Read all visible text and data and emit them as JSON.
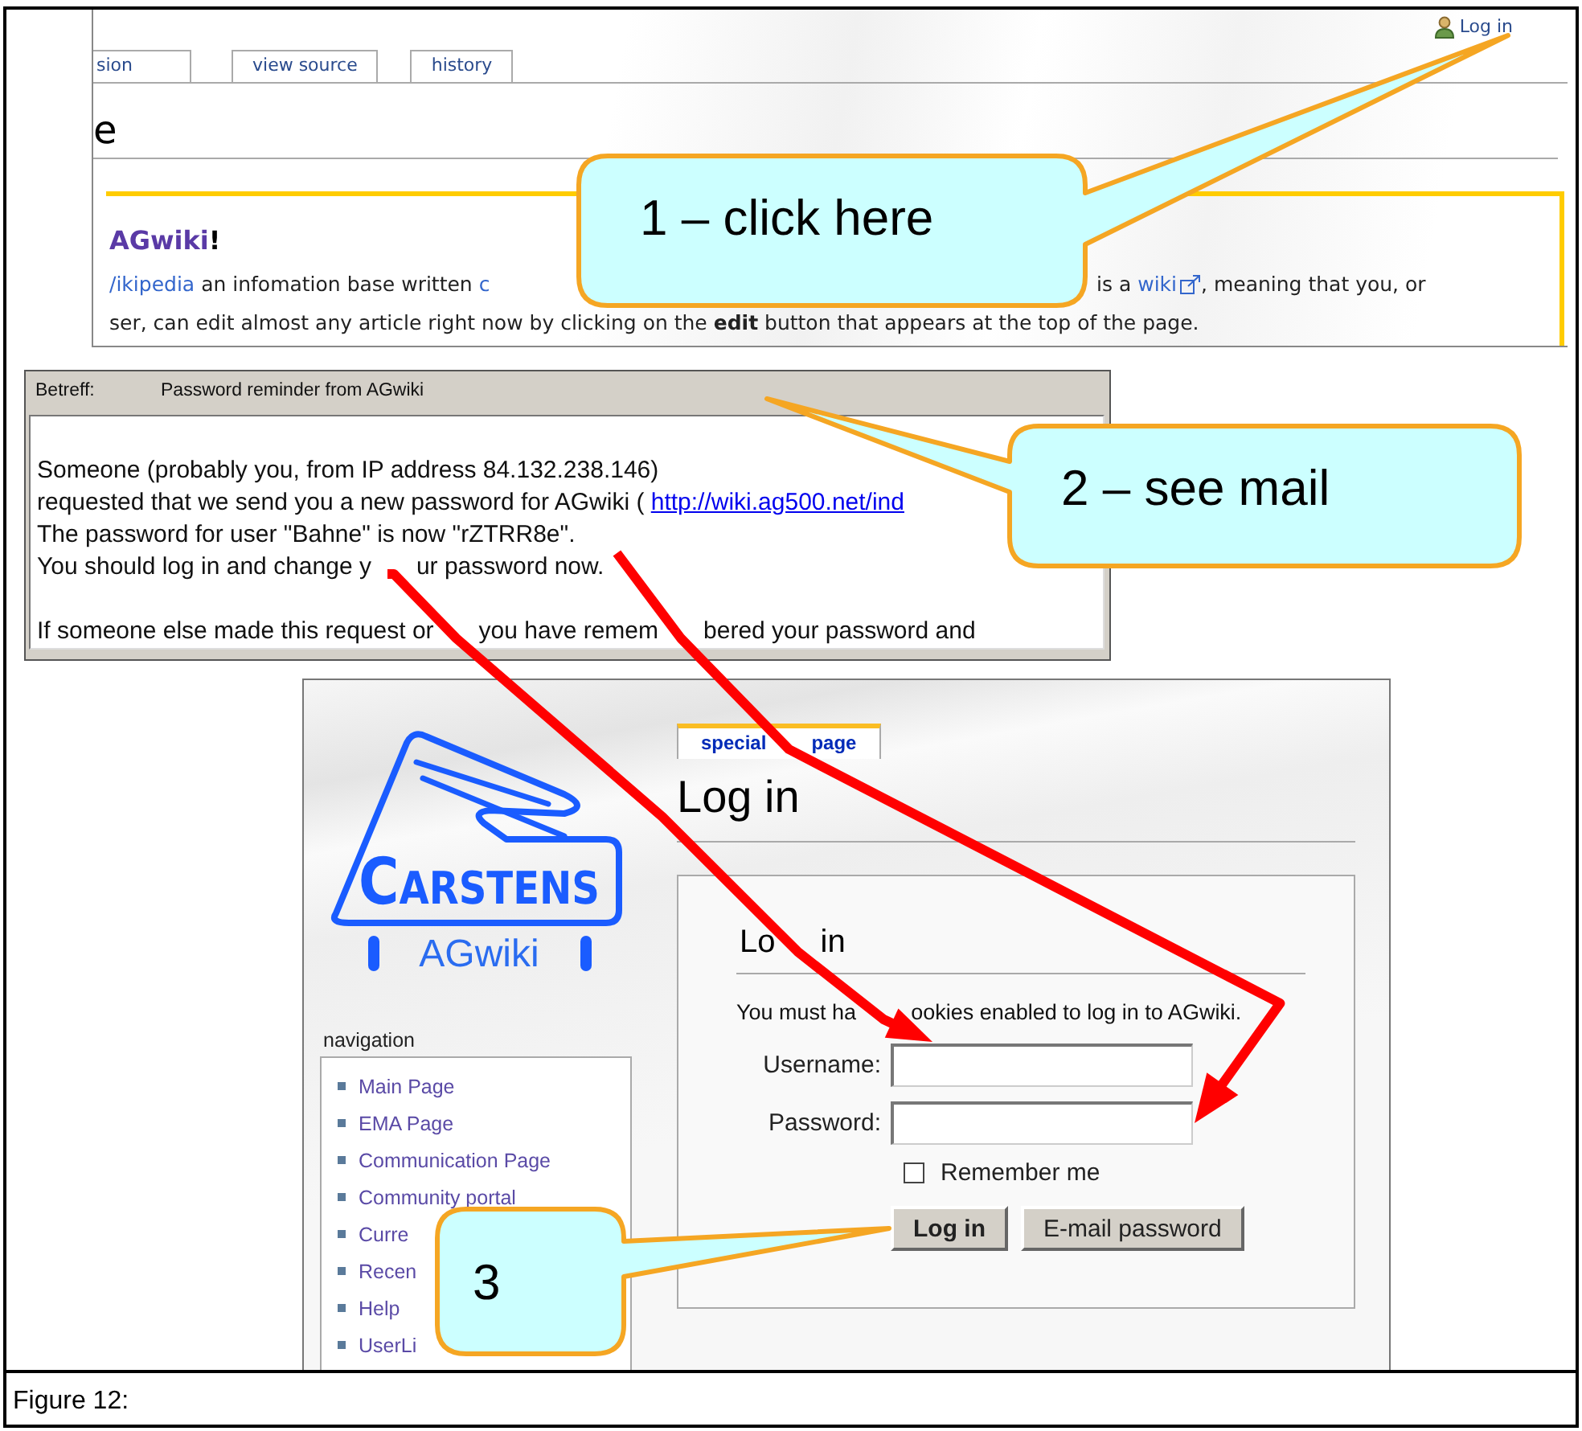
{
  "wiki_page": {
    "user_link": "Log in",
    "tabs": [
      "sion",
      "view source",
      "history"
    ],
    "heading": "e",
    "welcome": {
      "link": "AGwiki",
      "suffix": "!"
    },
    "intro_left": [
      {
        "kind": "link",
        "text": "/ikipedia"
      },
      {
        "kind": "plain",
        "text": " an infomation base written "
      },
      {
        "kind": "link",
        "text": "c"
      }
    ],
    "intro_right": [
      {
        "kind": "plain",
        "text": "is a "
      },
      {
        "kind": "external_link",
        "text": "wiki"
      },
      {
        "kind": "plain",
        "text": ", meaning that you, or"
      }
    ],
    "intro_line2": "ser, can edit almost any article right now by clicking on the **edit** button that appears at the top of the page."
  },
  "mail": {
    "subject_label": "Betreff:",
    "subject": "Password reminder from AGwiki",
    "paragraphs": [
      {
        "lines": [
          {
            "parts": [
              "Someone (probably you, from IP address 84.132.238.146)"
            ]
          },
          {
            "parts": [
              "requested that we send you a new password for AGwiki ( "
            ],
            "link": "http://wiki.ag500.net/ind"
          },
          {
            "parts": [
              "The password for user \"Bahne\" is now \"rZTRR8e\"."
            ]
          },
          {
            "parts": [
              "You should log in and change y",
              "ur password now."
            ]
          }
        ]
      },
      {
        "lines": [
          {
            "parts": [
              "If someone else made this request or",
              "you have remem",
              "bered your password and"
            ]
          }
        ]
      }
    ]
  },
  "login": {
    "logo": {
      "name": "CARSTENS",
      "wiki": "AGwiki"
    },
    "nav_title": "navigation",
    "nav_items": [
      "Main Page",
      "EMA Page",
      "Communication Page",
      "Community portal",
      "Curre",
      "Recen",
      "Help",
      "UserLi"
    ],
    "page_tab": {
      "label_parts": [
        "special",
        "page"
      ],
      "selected": true
    },
    "title": "Log in",
    "form": {
      "heading_parts": [
        "Lo",
        "in"
      ],
      "note_parts": [
        "You must ha",
        "ookies enabled to log in to AGwiki."
      ],
      "fields": [
        {
          "label": "Username:"
        },
        {
          "label": "Password:"
        }
      ],
      "remember": {
        "label": "Remember me",
        "checked": false
      },
      "buttons": [
        {
          "label": "Log in",
          "primary": true
        },
        {
          "label": "E-mail password",
          "primary": false
        }
      ]
    }
  },
  "callouts": [
    {
      "text": "1 – click here"
    },
    {
      "text": "2 – see mail"
    },
    {
      "text": "3"
    }
  ],
  "caption": "Figure 12:"
}
